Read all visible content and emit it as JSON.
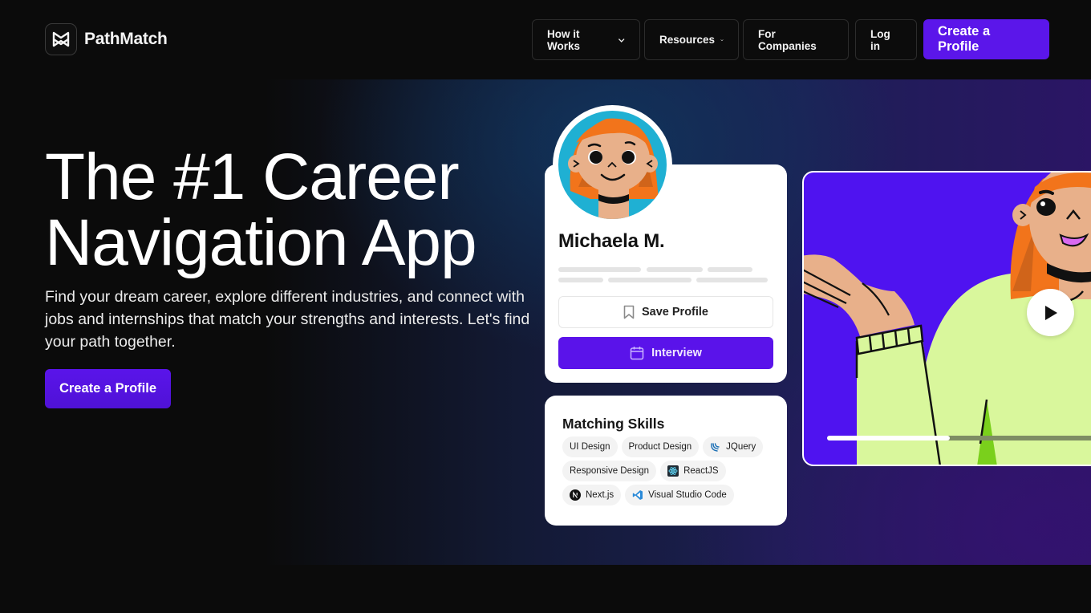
{
  "brand": {
    "name": "PathMatch",
    "logo_icon": "pathmatch-m-logo-icon"
  },
  "nav": {
    "items": [
      {
        "label": "How it Works",
        "has_dropdown": true
      },
      {
        "label": "Resources",
        "has_dropdown": true
      },
      {
        "label": "For Companies",
        "has_dropdown": false
      }
    ],
    "login_label": "Log in",
    "cta_label": "Create a Profile"
  },
  "hero": {
    "title_line1": "The #1 Career",
    "title_line2": "Navigation App",
    "subtitle": "Find your dream career, explore different industries, and connect with jobs and internships that match your strengths and interests. Let's find your path together.",
    "cta_label": "Create a Profile"
  },
  "profile_card": {
    "name": "Michaela M.",
    "save_label": "Save Profile",
    "save_icon": "bookmark-icon",
    "interview_label": "Interview",
    "interview_icon": "calendar-icon"
  },
  "skills_card": {
    "title": "Matching Skills",
    "skills": [
      {
        "label": "UI Design",
        "icon": null
      },
      {
        "label": "Product Design",
        "icon": null
      },
      {
        "label": "JQuery",
        "icon": "jquery-icon"
      },
      {
        "label": "Responsive Design",
        "icon": null
      },
      {
        "label": "ReactJS",
        "icon": "react-icon"
      },
      {
        "label": "Next.js",
        "icon": "nextjs-icon"
      },
      {
        "label": "Visual Studio Code",
        "icon": "vscode-icon"
      }
    ]
  },
  "video": {
    "progress": 0.45,
    "play_icon": "play-icon"
  },
  "colors": {
    "accent": "#5b16ea",
    "background": "#0b0b0b",
    "video_bg": "#4f13f0",
    "shirt": "#d9f79c",
    "hair": "#f2741b",
    "avatar_bg": "#1fb0d3"
  }
}
